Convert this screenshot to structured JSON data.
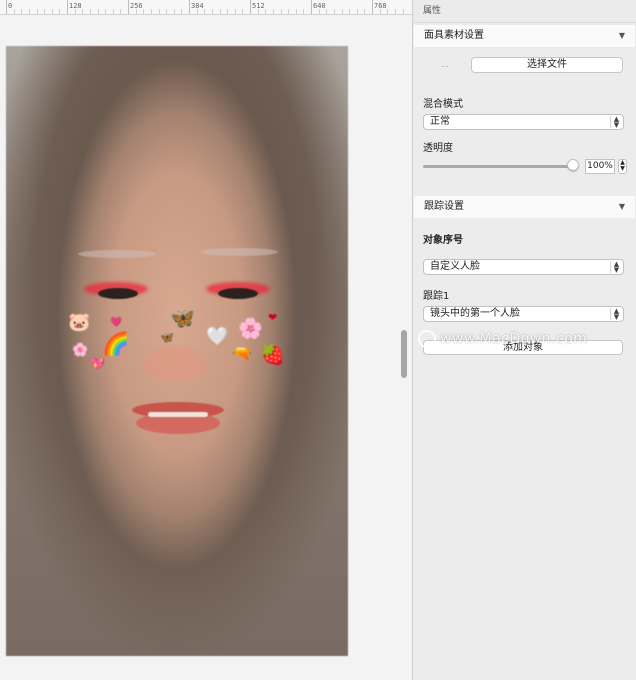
{
  "ruler": {
    "labels": [
      "0",
      "128",
      "256",
      "384",
      "512",
      "640",
      "768"
    ]
  },
  "canvas": {
    "stickers": [
      {
        "name": "pig-face-sticker",
        "glyph": "🐷"
      },
      {
        "name": "small-hearts-sticker",
        "glyph": "💗"
      },
      {
        "name": "butterfly-sticker",
        "glyph": "🦋"
      },
      {
        "name": "red-heart-sticker",
        "glyph": "❤"
      },
      {
        "name": "pink-flower-sticker",
        "glyph": "🌸"
      },
      {
        "name": "rainbow-sticker",
        "glyph": "🌈"
      },
      {
        "name": "small-butterfly-sticker",
        "glyph": "🦋"
      },
      {
        "name": "white-heart-sticker",
        "glyph": "🤍"
      },
      {
        "name": "pink-flower-left-sticker",
        "glyph": "🌸"
      },
      {
        "name": "pink-heart-sticker",
        "glyph": "💖"
      },
      {
        "name": "gun-sticker",
        "glyph": "🔫"
      },
      {
        "name": "strawberry-sticker",
        "glyph": "🍓"
      }
    ]
  },
  "inspector": {
    "title": "属性",
    "mask_section": {
      "title": "面具素材设置",
      "choose_file_label": "选择文件",
      "placeholder": "..."
    },
    "blend": {
      "label": "混合模式",
      "value": "正常"
    },
    "opacity": {
      "label": "透明度",
      "value": "100%",
      "level": 1.0
    },
    "tracking_section": {
      "title": "跟踪设置"
    },
    "object_index": {
      "label": "对象序号",
      "value": "自定义人脸"
    },
    "tracking1": {
      "label": "跟踪1",
      "value": "镜头中的第一个人脸"
    },
    "add_object_label": "添加对象",
    "watermark": "www.MacDown.com"
  }
}
